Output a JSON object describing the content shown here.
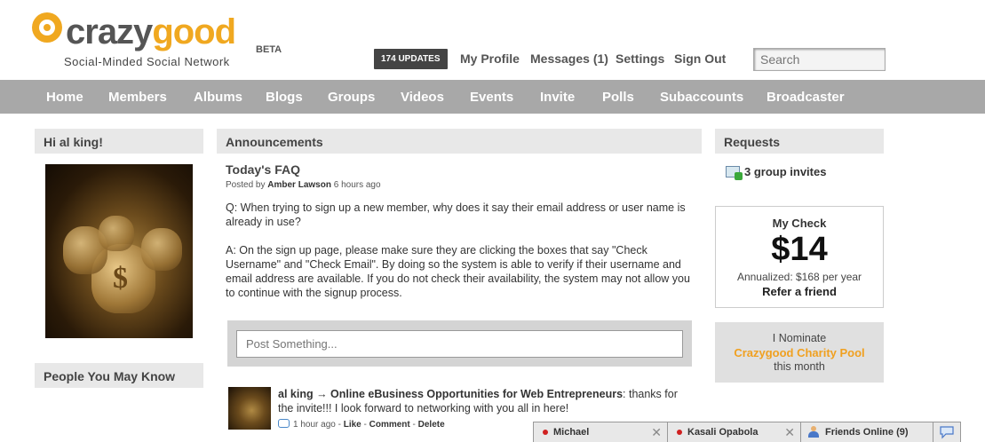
{
  "header": {
    "logo_crazy": "crazy",
    "logo_good": "good",
    "logo_beta": "BETA",
    "tagline": "Social-Minded Social Network",
    "updates_label": "174 UPDATES",
    "links": [
      "My Profile",
      "Messages (1)",
      "Settings",
      "Sign Out"
    ],
    "search_placeholder": "Search"
  },
  "nav": {
    "items": [
      "Home",
      "Members",
      "Albums",
      "Blogs",
      "Groups",
      "Videos",
      "Events",
      "Invite",
      "Polls",
      "Subaccounts",
      "Broadcaster"
    ]
  },
  "left": {
    "greeting": "Hi al king!",
    "people_title": "People You May Know"
  },
  "center": {
    "section_title": "Announcements",
    "faq_title": "Today's FAQ",
    "posted_prefix": "Posted by",
    "posted_author": "Amber Lawson",
    "posted_time": "6 hours ago",
    "question": "Q: When trying to sign up a new member, why does it say their email address or user name is already in use?",
    "answer": "A: On the sign up page, please make sure they are clicking the boxes that say \"Check Username\" and \"Check Email\".  By doing so the system is able to verify if their username and email address are available.  If you do not check their availability, the system may not allow you to continue with the signup process.",
    "post_placeholder": "Post Something...",
    "feed": {
      "headline": "al king → Online eBusiness Opportunities for Web Entrepreneurs",
      "text": ": thanks for the invite!!! I look forward to networking with you all in here!",
      "time": "1 hour ago",
      "sep": " - ",
      "like": "Like",
      "comment": "Comment",
      "delete": "Delete"
    }
  },
  "right": {
    "requests_title": "Requests",
    "invites": "3 group invites",
    "check_title": "My Check",
    "check_amount": "$14",
    "check_annualized": "Annualized: $168 per year",
    "check_refer": "Refer a friend",
    "nominate_l1": "I Nominate",
    "nominate_l2": "Crazygood Charity Pool",
    "nominate_l3": "this month"
  },
  "chat": {
    "tabs": [
      "Michael",
      "Kasali Opabola"
    ],
    "friends_online": "Friends Online (9)",
    "close_glyph": "✕"
  },
  "colors": {
    "accent_orange": "#f0a820",
    "nav_gray": "#a8a8a8",
    "box_head_gray": "#e8e8e8"
  }
}
